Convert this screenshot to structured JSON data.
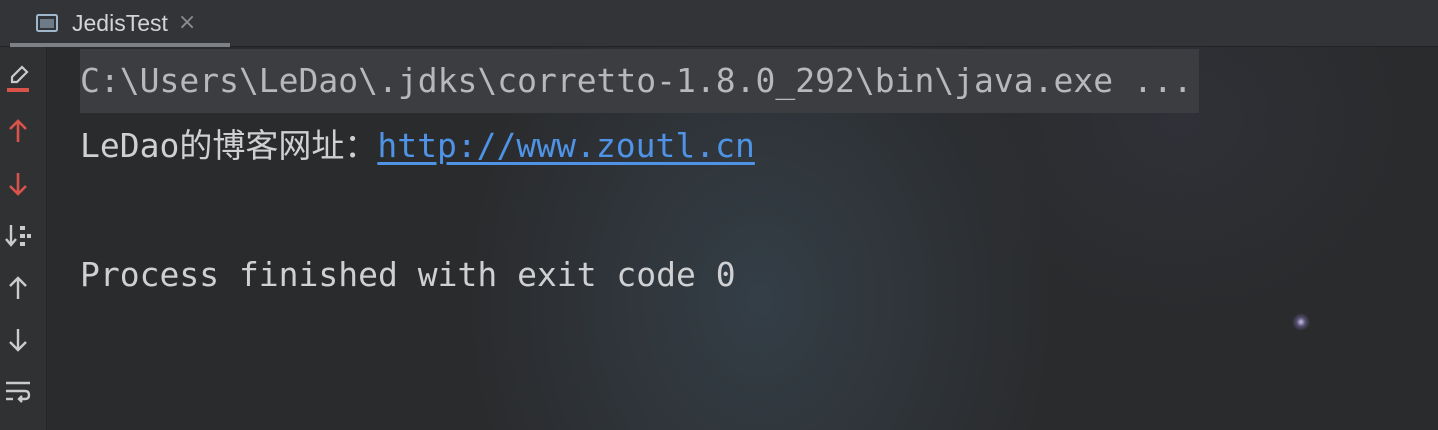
{
  "tab": {
    "label": "JedisTest",
    "close_glyph": "×",
    "icon": "console-window-icon"
  },
  "toolbar": {
    "items": [
      {
        "name": "clear-all-icon",
        "color": "#d9534a"
      },
      {
        "name": "up-stack-frame-icon",
        "color": "#d9534a"
      },
      {
        "name": "down-stack-frame-icon",
        "color": "#d9534a"
      },
      {
        "name": "sort-icon",
        "color": "#c9cbcd"
      },
      {
        "name": "scroll-up-icon",
        "color": "#c9cbcd"
      },
      {
        "name": "scroll-down-icon",
        "color": "#c9cbcd"
      },
      {
        "name": "soft-wrap-icon",
        "color": "#c9cbcd"
      }
    ]
  },
  "console": {
    "command": "C:\\Users\\LeDao\\.jdks\\corretto-1.8.0_292\\bin\\java.exe ...",
    "output_prefix": "LeDao的博客网址：",
    "output_link": "http://www.zoutl.cn",
    "exit_message": "Process finished with exit code 0"
  },
  "colors": {
    "link": "#4f93e6",
    "accent_red": "#d9534a",
    "text": "#cfd0d2"
  }
}
